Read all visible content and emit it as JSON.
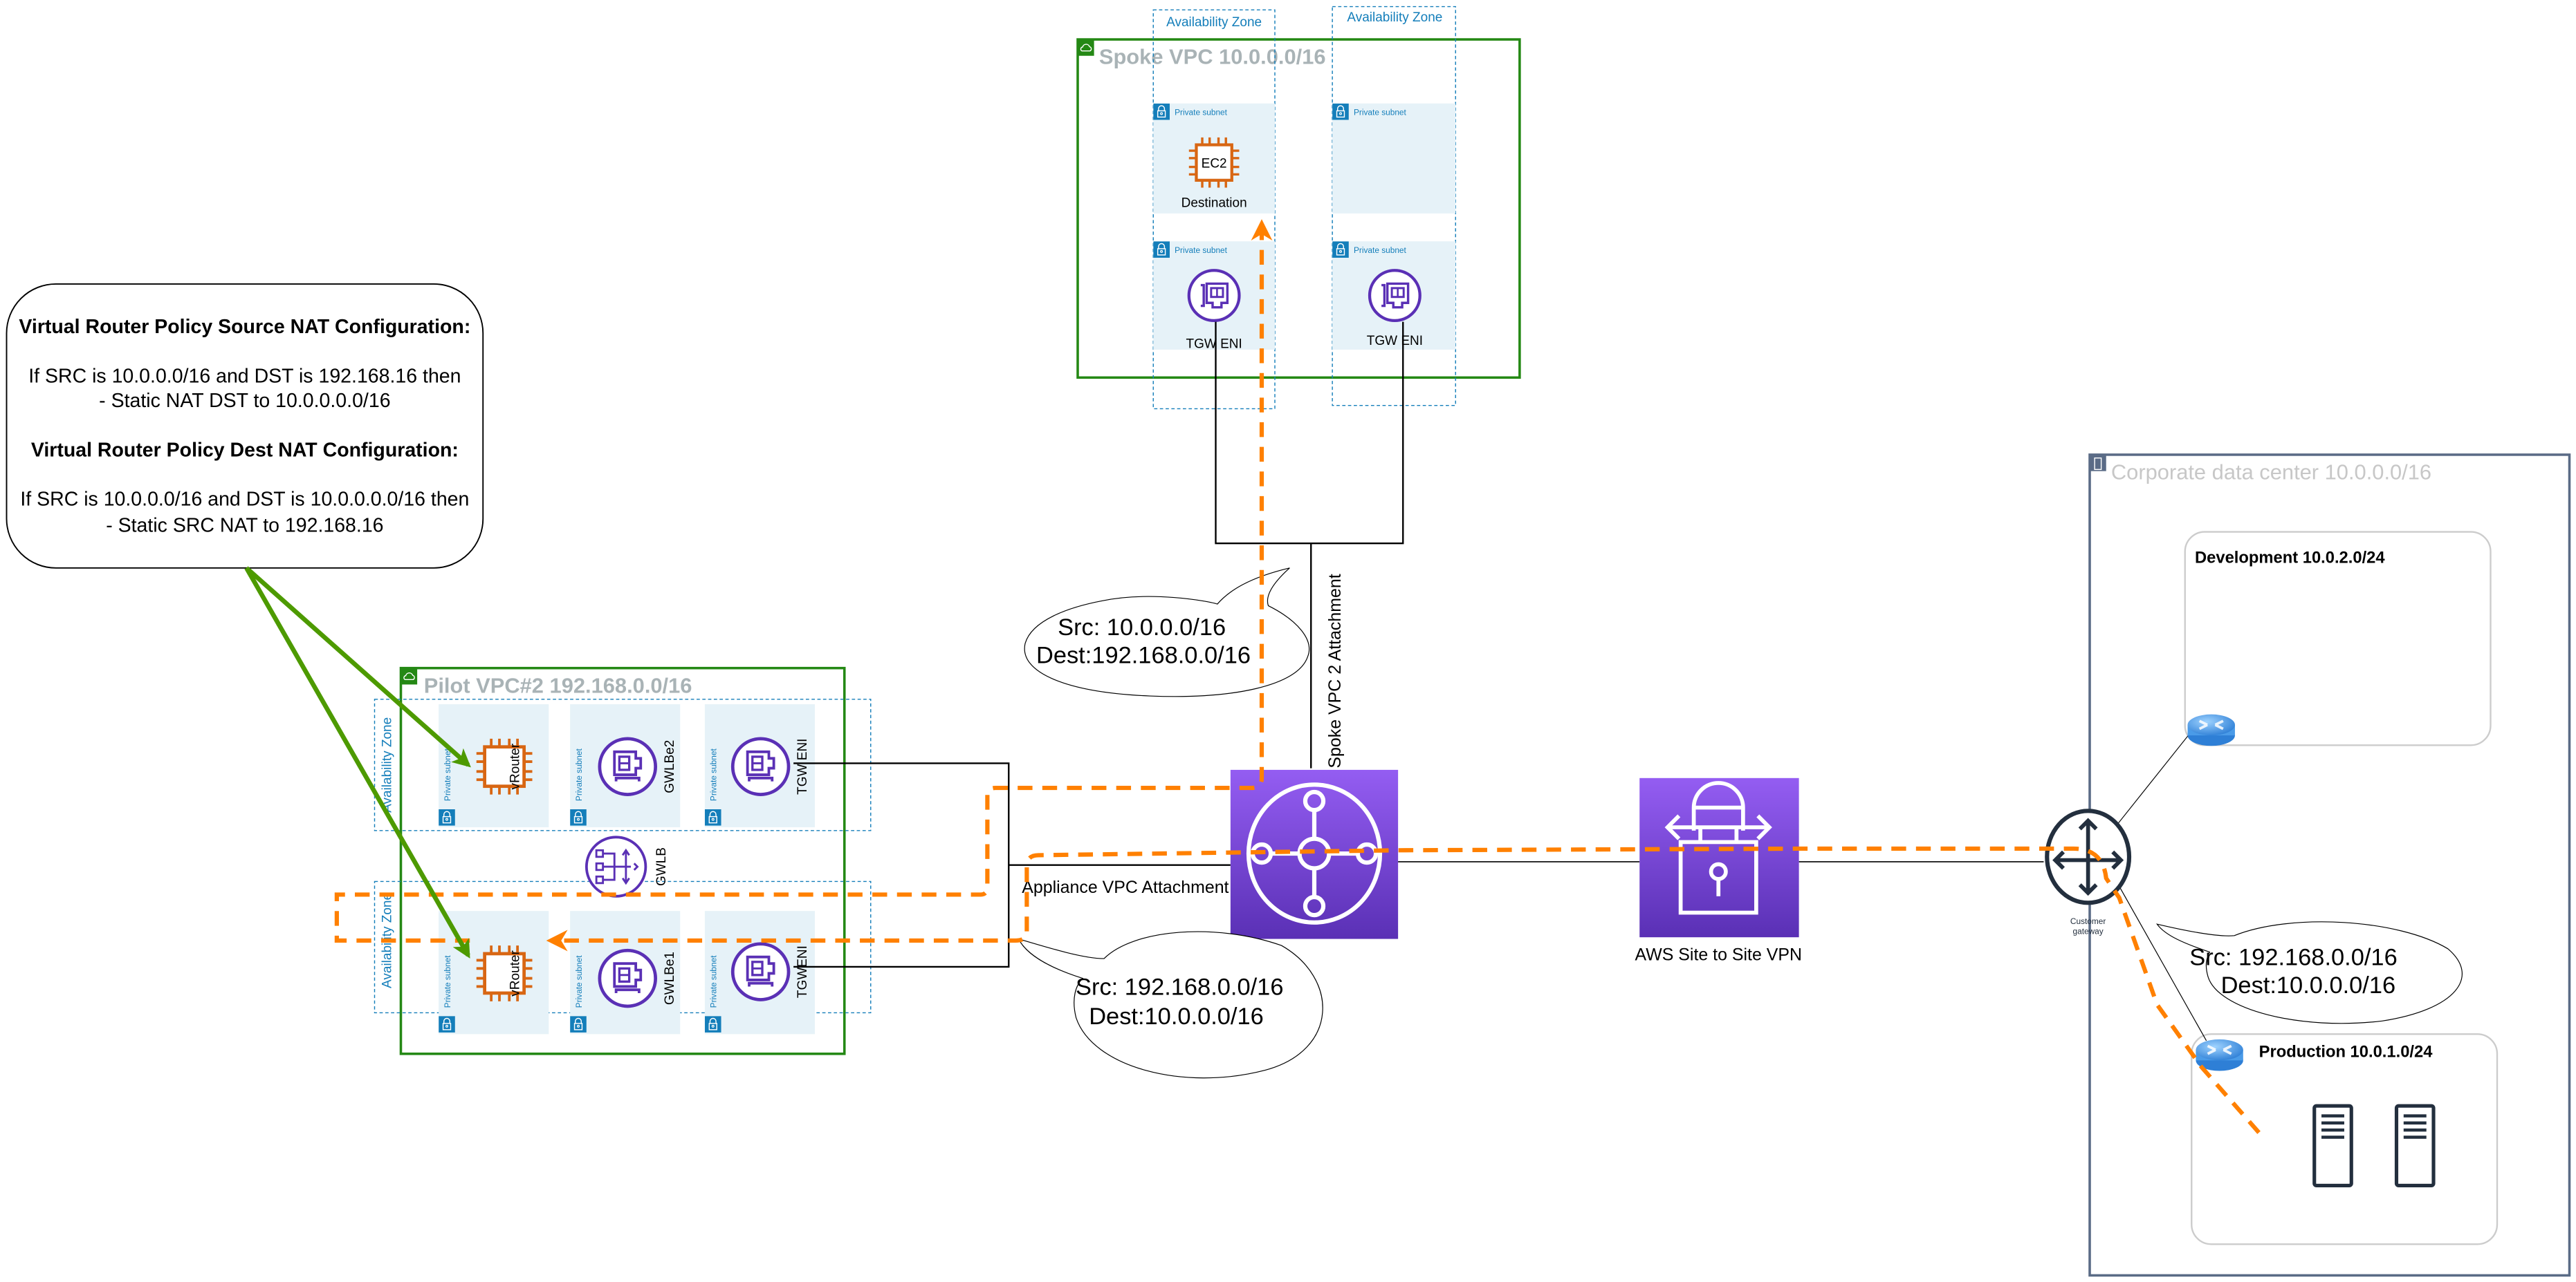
{
  "colors": {
    "vpc_border": "#248814",
    "az_border": "#147EBA",
    "subnet_fill": "#E6F2F8",
    "ec2_orange": "#D86613",
    "purple_icon": "#5A30B5",
    "tgw_gradient_top": "#945DF2",
    "tgw_gradient_bottom": "#5A30B5",
    "traffic_path": "#FF8000",
    "annotation_arrow": "#4D9A00",
    "dc_border": "#5A6B86"
  },
  "nat_note": {
    "source_heading": "Virtual Router Policy Source NAT Configuration:",
    "source_line1": "If SRC is 10.0.0.0/16 and DST is 192.168.16 then",
    "source_line2": "- Static NAT DST to 10.0.0.0.0/16",
    "dest_heading": "Virtual Router Policy Dest NAT Configuration:",
    "dest_line1": "If SRC is 10.0.0.0/16 and DST is 10.0.0.0.0/16 then",
    "dest_line2": "- Static SRC NAT to 192.168.16"
  },
  "spoke_vpc": {
    "title": "Spoke VPC 10.0.0.0/16",
    "az_labels": [
      "Availability Zone",
      "Availability Zone"
    ],
    "subnet_label": "Private subnet",
    "ec2_icon_text": "EC2",
    "ec2_label": "Destination",
    "eni_labels": [
      "TGW ENI",
      "TGW ENI"
    ]
  },
  "pilot_vpc": {
    "title": "Pilot VPC#2 192.168.0.0/16",
    "az_label": "Availability Zone",
    "subnet_label": "Private subnet",
    "az1": {
      "router": "vRouter",
      "gwlbe": "GWLBe2",
      "eni": "TGW ENI"
    },
    "az2": {
      "router": "vRouter",
      "gwlbe": "GWLBe1",
      "eni": "TGWENI"
    },
    "gwlb_label": "GWLB"
  },
  "attachments": {
    "spoke": "Spoke VPC 2 Attachment",
    "appliance": "Appliance VPC Attachment"
  },
  "bubbles": {
    "upper": {
      "line1": "Src: 10.0.0.0/16",
      "line2": "Dest:192.168.0.0/16"
    },
    "lower": {
      "line1": "Src: 192.168.0.0/16",
      "line2": "Dest:10.0.0.0/16"
    },
    "right": {
      "line1": "Src: 192.168.0.0/16",
      "line2": "Dest:10.0.0.0/16"
    }
  },
  "vpn": {
    "label": "AWS Site to Site VPN"
  },
  "corporate_dc": {
    "title": "Corporate data center 10.0.0.0/16",
    "customer_gateway_line1": "Customer",
    "customer_gateway_line2": "gateway",
    "development": "Development 10.0.2.0/24",
    "production": "Production 10.0.1.0/24"
  }
}
